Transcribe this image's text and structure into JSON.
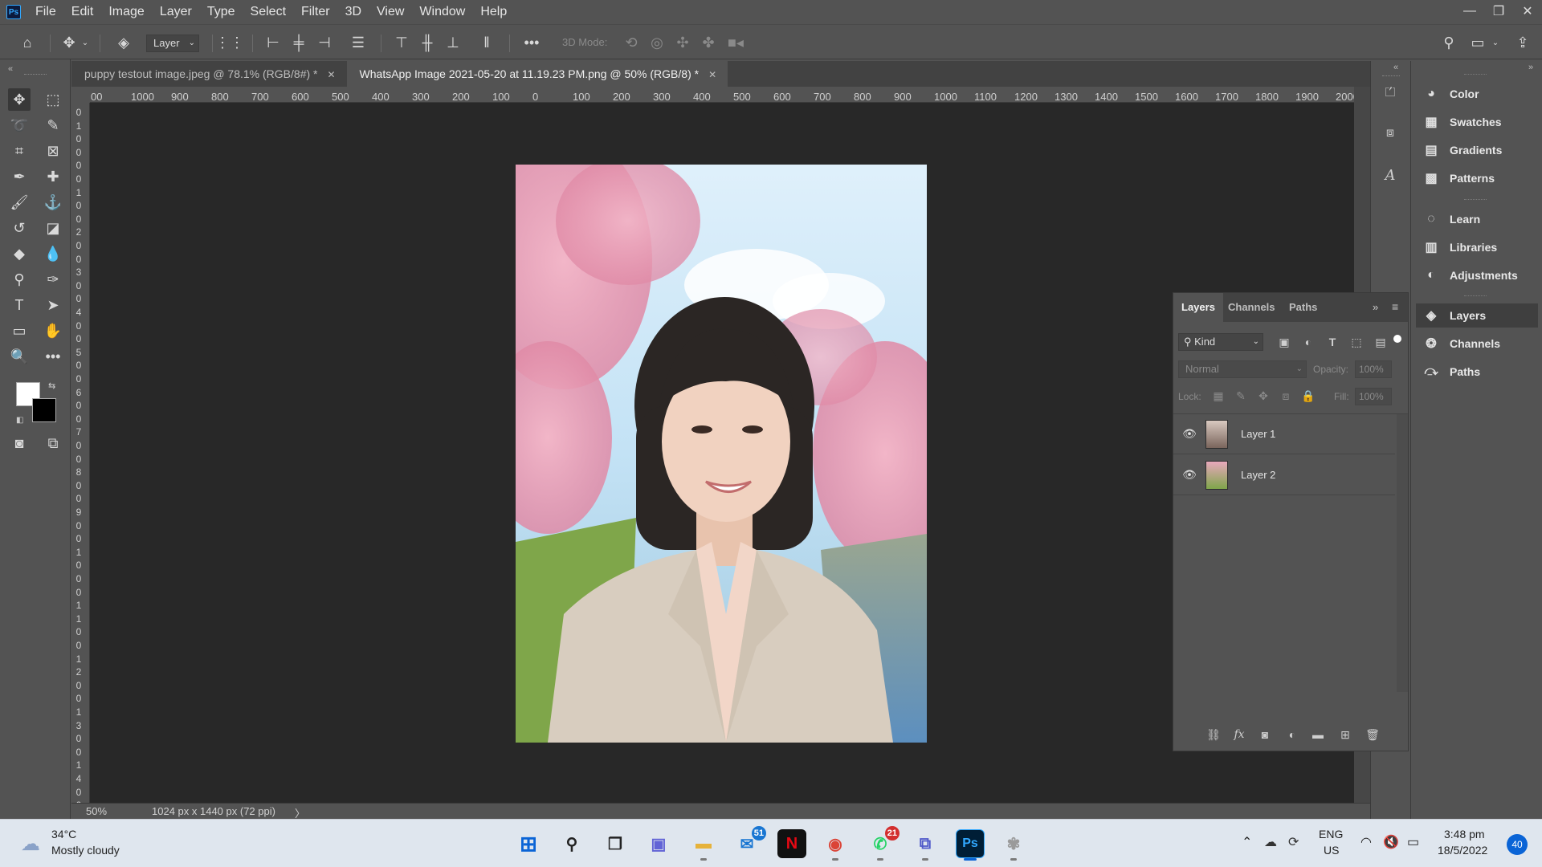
{
  "menubar": {
    "logo": "Ps",
    "items": [
      "File",
      "Edit",
      "Image",
      "Layer",
      "Type",
      "Select",
      "Filter",
      "3D",
      "View",
      "Window",
      "Help"
    ]
  },
  "optionsbar": {
    "layer_select": "Layer",
    "three_d_mode": "3D Mode:"
  },
  "tabs": [
    {
      "label": "puppy testout image.jpeg @ 78.1% (RGB/8#) *"
    },
    {
      "label": "WhatsApp Image 2021-05-20 at 11.19.23 PM.png @ 50% (RGB/8) *"
    }
  ],
  "ruler": {
    "top": [
      "00",
      "1000",
      "900",
      "800",
      "700",
      "600",
      "500",
      "400",
      "300",
      "200",
      "100",
      "0",
      "100",
      "200",
      "300",
      "400",
      "500",
      "600",
      "700",
      "800",
      "900",
      "1000",
      "1100",
      "1200",
      "1300",
      "1400",
      "1500",
      "1600",
      "1700",
      "1800",
      "1900",
      "2000"
    ],
    "left": [
      "0",
      "1",
      "0",
      "0",
      "0",
      "0",
      "1",
      "0",
      "0",
      "2",
      "0",
      "0",
      "3",
      "0",
      "0",
      "4",
      "0",
      "0",
      "5",
      "0",
      "0",
      "6",
      "0",
      "0",
      "7",
      "0",
      "0",
      "8",
      "0",
      "0",
      "9",
      "0",
      "0",
      "1",
      "0",
      "0",
      "0",
      "1",
      "1",
      "0",
      "0",
      "1",
      "2",
      "0",
      "0",
      "1",
      "3",
      "0",
      "0",
      "1",
      "4",
      "0",
      "0",
      "1",
      "5"
    ]
  },
  "status": {
    "zoom": "50%",
    "doc_info": "1024 px x 1440 px (72 ppi)",
    "arrow": "〉"
  },
  "right_column": {
    "group1": [
      "Color",
      "Swatches",
      "Gradients",
      "Patterns"
    ],
    "group2": [
      "Learn",
      "Libraries",
      "Adjustments"
    ],
    "group3": [
      "Layers",
      "Channels",
      "Paths"
    ]
  },
  "layers_panel": {
    "tabs": [
      "Layers",
      "Channels",
      "Paths"
    ],
    "filter_kind": "Kind",
    "blend_mode": "Normal",
    "opacity_label": "Opacity:",
    "opacity_value": "100%",
    "lock_label": "Lock:",
    "fill_label": "Fill:",
    "fill_value": "100%",
    "layers": [
      {
        "name": "Layer 1"
      },
      {
        "name": "Layer 2"
      }
    ]
  },
  "taskbar": {
    "weather_temp": "34°C",
    "weather_desc": "Mostly cloudy",
    "badges": {
      "mail": "51",
      "whatsapp": "21"
    },
    "lang": "ENG",
    "region": "US",
    "time": "3:48 pm",
    "date": "18/5/2022",
    "notif_count": "40"
  },
  "colors": {
    "ps_blue": "#31a8ff",
    "panel_bg": "#535353",
    "canvas_bg": "#282828",
    "taskbar_bg": "#dfe6ee"
  }
}
